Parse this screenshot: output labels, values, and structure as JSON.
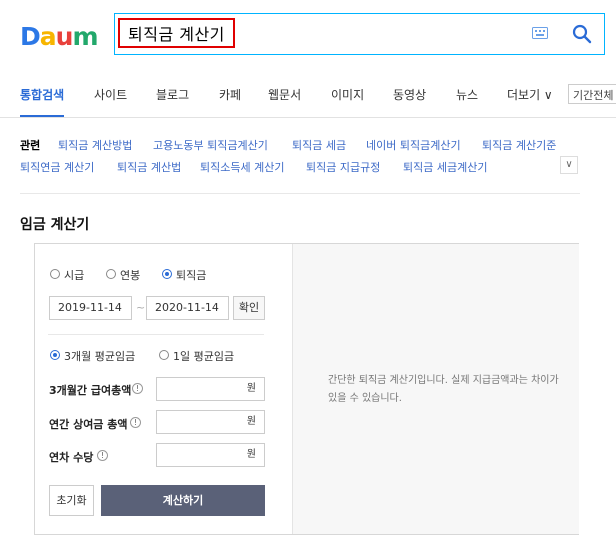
{
  "brand": {
    "logo_letters": [
      "D",
      "a",
      "u",
      "m"
    ],
    "colors": {
      "d": "#2c78e6",
      "a": "#f7b500",
      "u": "#e8413c",
      "m": "#22a86b",
      "accent": "#2a6bd6",
      "link": "#3d6ac7",
      "query_border": "#e00000",
      "search_border": "#00b4ff",
      "calc_button": "#5a6178"
    }
  },
  "search": {
    "query": "퇴직금 계산기",
    "keyboard_icon": "keyboard-icon",
    "search_icon": "search-icon"
  },
  "tabs": [
    {
      "label": "통합검색",
      "active": true
    },
    {
      "label": "사이트"
    },
    {
      "label": "블로그"
    },
    {
      "label": "카페"
    },
    {
      "label": "웹문서"
    },
    {
      "label": "이미지"
    },
    {
      "label": "동영상"
    },
    {
      "label": "뉴스"
    },
    {
      "label": "더보기 ∨"
    }
  ],
  "period_filter": "기간전체",
  "related": {
    "label": "관련",
    "row1": [
      "퇴직금 계산방법",
      "고용노동부 퇴직금계산기",
      "퇴직금 세금",
      "네이버 퇴직금계산기",
      "퇴직금 계산기준"
    ],
    "row2": [
      "퇴직연금 계산기",
      "퇴직금 계산법",
      "퇴직소득세 계산기",
      "퇴직금 지급규정",
      "퇴직금 세금계산기"
    ],
    "more_icon": "chevron-down-icon"
  },
  "calculator": {
    "title": "임금 계산기",
    "type_options": [
      {
        "label": "시급",
        "selected": false
      },
      {
        "label": "연봉",
        "selected": false
      },
      {
        "label": "퇴직금",
        "selected": true
      }
    ],
    "start_date": "2019-11-14",
    "date_separator": "~",
    "end_date": "2020-11-14",
    "confirm_label": "확인",
    "basis_options": [
      {
        "label": "3개월 평균임금",
        "selected": true
      },
      {
        "label": "1일 평균임금",
        "selected": false
      }
    ],
    "fields": [
      {
        "label": "3개월간 급여총액",
        "value": "",
        "unit": "원"
      },
      {
        "label": "연간 상여금 총액",
        "value": "",
        "unit": "원"
      },
      {
        "label": "연차 수당",
        "value": "",
        "unit": "원"
      }
    ],
    "help_symbol": "!",
    "reset_label": "초기화",
    "calc_label": "계산하기",
    "info_text": "간단한 퇴직금 계산기입니다. 실제 지급금액과는 차이가 있을 수 있습니다."
  }
}
